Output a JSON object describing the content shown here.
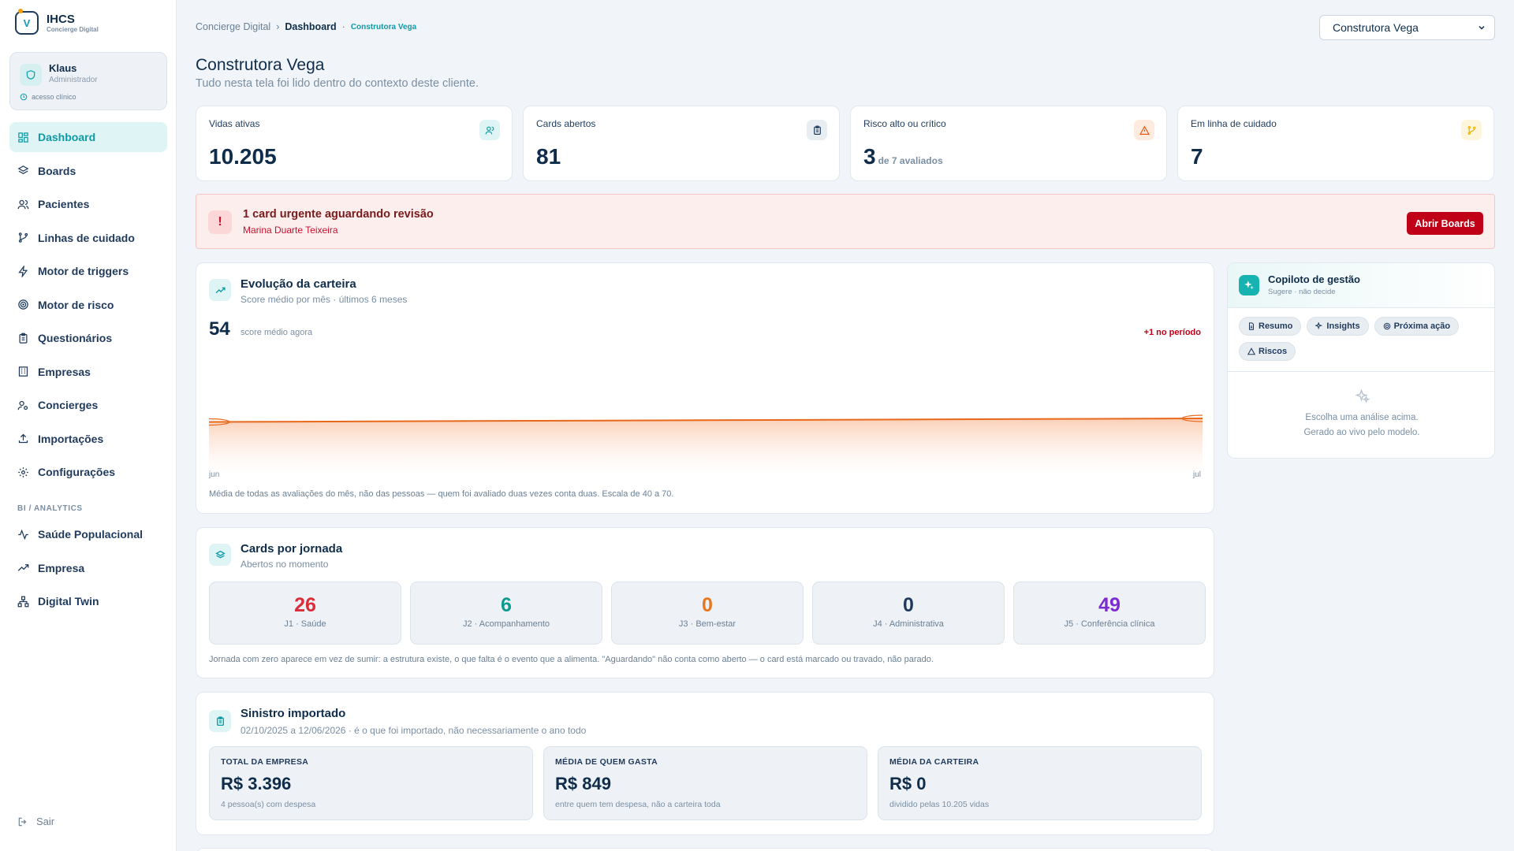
{
  "brand": {
    "name": "IHCS",
    "tagline": "Concierge Digital",
    "mark": "V"
  },
  "user": {
    "name": "Klaus",
    "role": "Administrador",
    "access": "acesso clínico"
  },
  "nav": {
    "items": [
      {
        "label": "Dashboard",
        "icon": "dashboard-icon",
        "active": true
      },
      {
        "label": "Boards",
        "icon": "layers-icon"
      },
      {
        "label": "Pacientes",
        "icon": "users-icon"
      },
      {
        "label": "Linhas de cuidado",
        "icon": "git-branch-icon"
      },
      {
        "label": "Motor de triggers",
        "icon": "zap-icon"
      },
      {
        "label": "Motor de risco",
        "icon": "target-icon"
      },
      {
        "label": "Questionários",
        "icon": "clipboard-icon"
      },
      {
        "label": "Empresas",
        "icon": "building-icon"
      },
      {
        "label": "Concierges",
        "icon": "user-cog-icon"
      },
      {
        "label": "Importações",
        "icon": "upload-icon"
      },
      {
        "label": "Configurações",
        "icon": "gear-icon"
      }
    ],
    "bi_section_label": "BI / ANALYTICS",
    "bi_items": [
      {
        "label": "Saúde Populacional",
        "icon": "activity-icon"
      },
      {
        "label": "Empresa",
        "icon": "trending-up-icon"
      },
      {
        "label": "Digital Twin",
        "icon": "network-icon"
      }
    ],
    "logout": "Sair"
  },
  "breadcrumb": {
    "root": "Concierge Digital",
    "current": "Dashboard",
    "context": "Construtora Vega",
    "sep": "›",
    "dot": "·"
  },
  "client_select": {
    "value": "Construtora Vega"
  },
  "page": {
    "title": "Construtora Vega",
    "subtitle": "Tudo nesta tela foi lido dentro do contexto deste cliente."
  },
  "kpis": [
    {
      "label": "Vidas ativas",
      "value": "10.205",
      "suffix": "",
      "icon": "users-icon",
      "color": "#0e9aa7",
      "bg": "#dff4f4"
    },
    {
      "label": "Cards abertos",
      "value": "81",
      "suffix": "",
      "icon": "clipboard-icon",
      "color": "#1f3a5c",
      "bg": "#e8edf2"
    },
    {
      "label": "Risco alto ou crítico",
      "value": "3",
      "suffix": "de 7 avaliados",
      "icon": "alert-triangle-icon",
      "color": "#ea580c",
      "bg": "#fdebe0"
    },
    {
      "label": "Em linha de cuidado",
      "value": "7",
      "suffix": "",
      "icon": "git-branch-icon",
      "color": "#eab308",
      "bg": "#fdf6dc"
    }
  ],
  "alert": {
    "icon": "!",
    "title": "1 card urgente aguardando revisão",
    "subtitle": "Marina Duarte Teixeira",
    "button": "Abrir Boards"
  },
  "evolucao": {
    "title": "Evolução da carteira",
    "subtitle": "Score médio por mês · últimos 6 meses",
    "current": "54",
    "current_label": "score médio agora",
    "delta": "+1 no período",
    "note": "Média de todas as avaliações do mês, não das pessoas — quem foi avaliado duas vezes conta duas. Escala de 40 a 70.",
    "line_color": "#e8681c"
  },
  "chart_data": {
    "type": "area",
    "x": [
      "jun",
      "jul"
    ],
    "values": [
      53,
      54
    ],
    "ylim": [
      40,
      70
    ],
    "title": "",
    "xlabel": "",
    "ylabel": ""
  },
  "jornadas": {
    "title": "Cards por jornada",
    "subtitle": "Abertos no momento",
    "items": [
      {
        "value": "26",
        "label": "J1 · Saúde",
        "color": "#d92d3a"
      },
      {
        "value": "6",
        "label": "J2 · Acompanhamento",
        "color": "#0e9a8f"
      },
      {
        "value": "0",
        "label": "J3 · Bem-estar",
        "color": "#e8761c"
      },
      {
        "value": "0",
        "label": "J4 · Administrativa",
        "color": "#1f3a5c"
      },
      {
        "value": "49",
        "label": "J5 · Conferência clínica",
        "color": "#7c2bd1"
      }
    ],
    "note": "Jornada com zero aparece em vez de sumir: a estrutura existe, o que falta é o evento que a alimenta. \"Aguardando\" não conta como aberto — o card está marcado ou travado, não parado."
  },
  "sinistro": {
    "title": "Sinistro importado",
    "subtitle": "02/10/2025 a 12/06/2026 · é o que foi importado, não necessariamente o ano todo",
    "boxes": [
      {
        "heading": "TOTAL DA EMPRESA",
        "value": "R$ 3.396",
        "sub": "4 pessoa(s) com despesa"
      },
      {
        "heading": "MÉDIA DE QUEM GASTA",
        "value": "R$ 849",
        "sub": "entre quem tem despesa, não a carteira toda"
      },
      {
        "heading": "MÉDIA DA CARTEIRA",
        "value": "R$ 0",
        "sub": "dividido pelas 10.205 vidas"
      }
    ]
  },
  "copilot": {
    "title": "Copiloto de gestão",
    "subtitle": "Sugere · não decide",
    "chips": [
      {
        "label": "Resumo",
        "icon": "file-icon"
      },
      {
        "label": "Insights",
        "icon": "sparkles-icon"
      },
      {
        "label": "Próxima ação",
        "icon": "target-icon"
      },
      {
        "label": "Riscos",
        "icon": "alert-triangle-icon"
      }
    ],
    "empty_line1": "Escolha uma análise acima.",
    "empty_line2": "Gerado ao vivo pelo modelo."
  }
}
